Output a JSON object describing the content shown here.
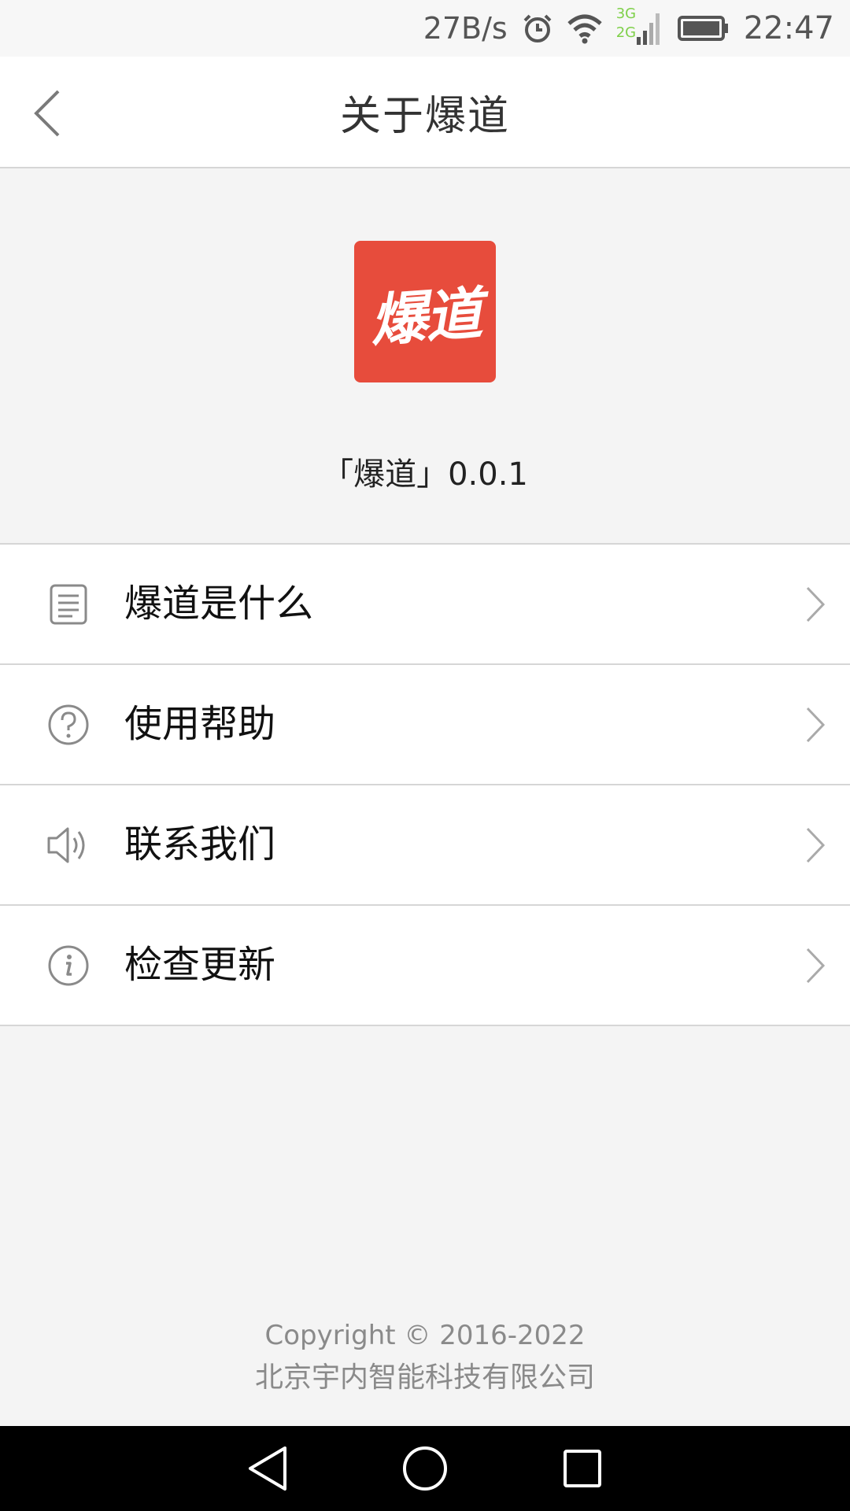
{
  "status_bar": {
    "net_speed": "27B/s",
    "network_label_3g": "3G",
    "network_label_2g": "2G",
    "time": "22:47",
    "icons": [
      "alarm-icon",
      "wifi-icon",
      "signal-icon",
      "battery-icon"
    ]
  },
  "header": {
    "title": "关于爆道",
    "back_icon": "chevron-left-icon"
  },
  "app": {
    "logo_text": "爆道",
    "logo_color": "#e74c3c",
    "version": "「爆道」0.0.1"
  },
  "menu": {
    "items": [
      {
        "label": "爆道是什么",
        "icon": "document-icon"
      },
      {
        "label": "使用帮助",
        "icon": "help-icon"
      },
      {
        "label": "联系我们",
        "icon": "speaker-icon"
      },
      {
        "label": "检查更新",
        "icon": "info-icon"
      }
    ]
  },
  "footer": {
    "copyright": "Copyright © 2016-2022",
    "company": "北京宇内智能科技有限公司"
  },
  "nav_bar": {
    "buttons": [
      "back-triangle-icon",
      "home-circle-icon",
      "recents-square-icon"
    ]
  }
}
